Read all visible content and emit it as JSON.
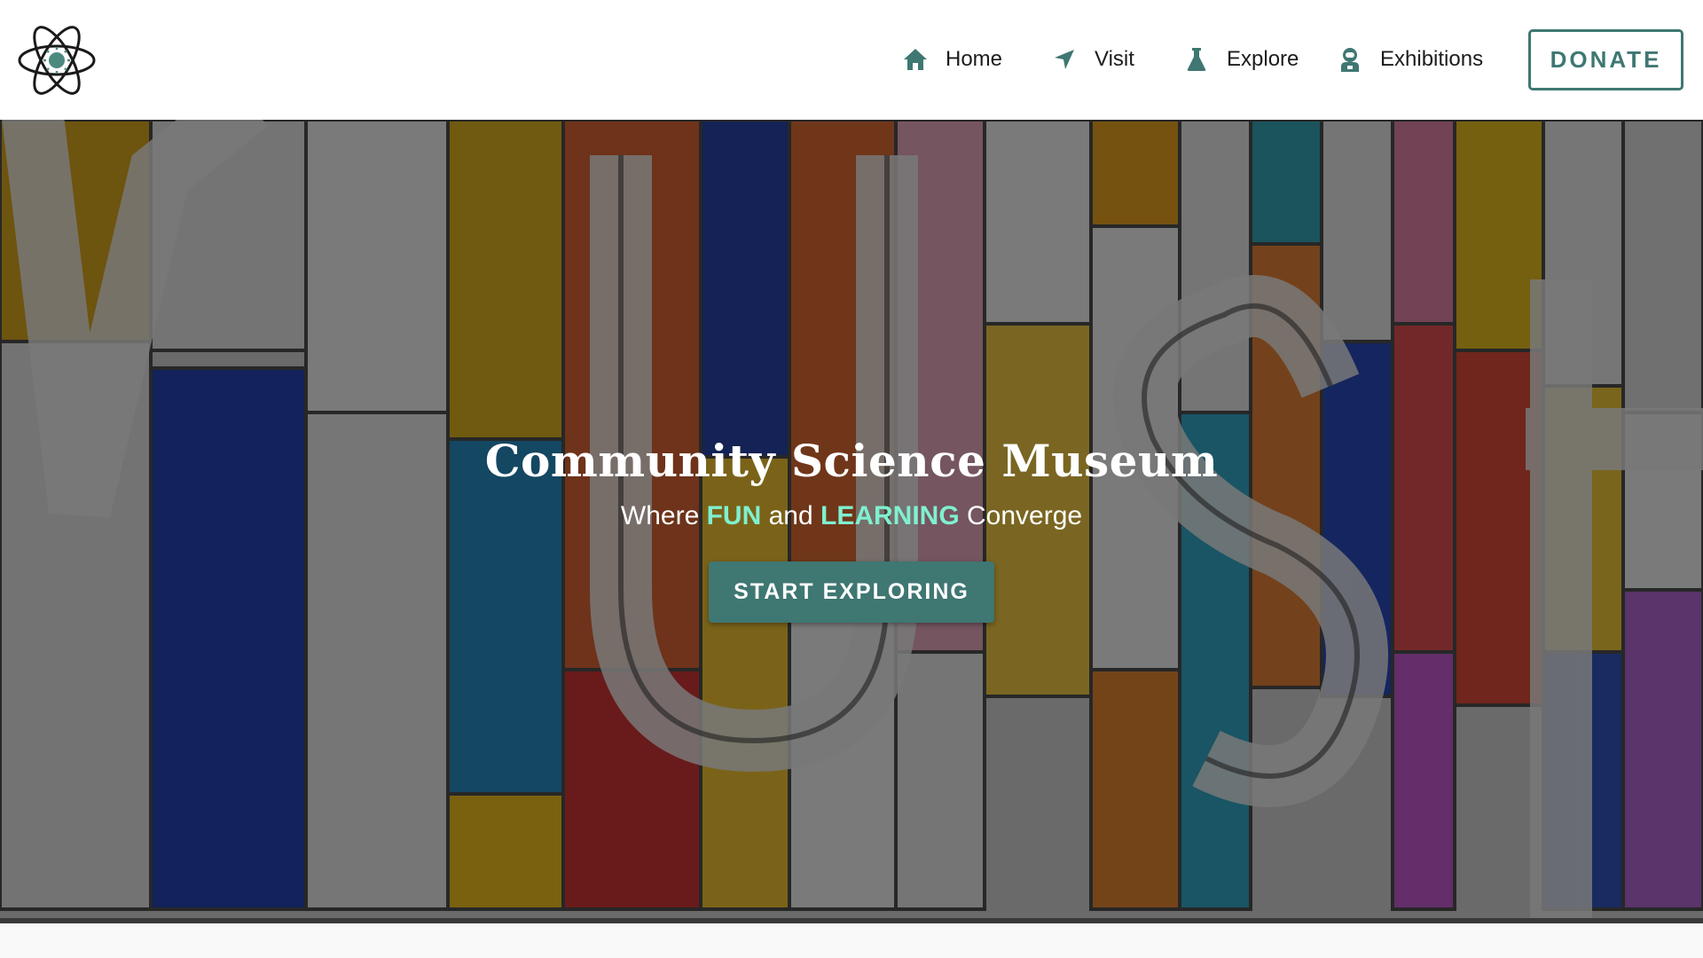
{
  "nav": {
    "items": [
      {
        "label": "Home",
        "icon": "home-icon"
      },
      {
        "label": "Visit",
        "icon": "location-arrow-icon"
      },
      {
        "label": "Explore",
        "icon": "flask-icon"
      },
      {
        "label": "Exhibitions",
        "icon": "astronaut-icon"
      }
    ],
    "donate_label": "DONATE"
  },
  "hero": {
    "title": "Community Science Museum",
    "subtitle": {
      "prefix": "Where ",
      "highlight1": "FUN",
      "middle": " and ",
      "highlight2": "LEARNING",
      "suffix": " Converge"
    },
    "cta_label": "START EXPLORING"
  },
  "colors": {
    "brand": "#3f7772",
    "highlight": "#7ff0cf",
    "logo_core": "#4c8a80"
  }
}
